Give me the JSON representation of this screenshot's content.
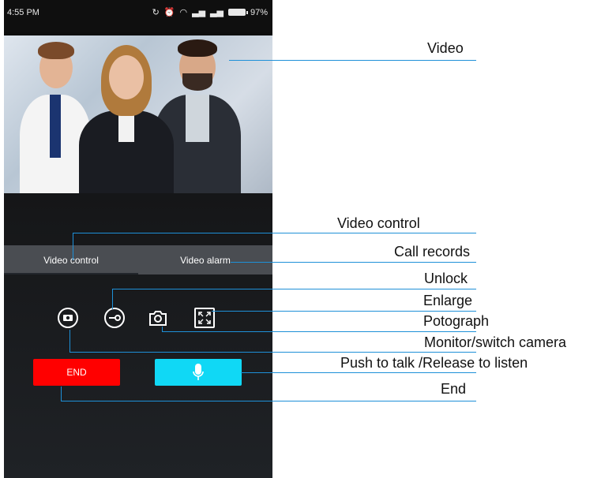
{
  "status_bar": {
    "time": "4:55 PM",
    "battery": "97%"
  },
  "tabs": {
    "video_control": "Video control",
    "video_alarm": "Video alarm"
  },
  "buttons": {
    "end": "END"
  },
  "annotations": {
    "video": "Video",
    "video_control": "Video control",
    "call_records": "Call records",
    "unlock": "Unlock",
    "enlarge": "Enlarge",
    "photograph": "Potograph",
    "monitor": "Monitor/switch camera",
    "push_to_talk": "Push to talk /Release to listen",
    "end": "End"
  },
  "colors": {
    "end_button": "#ff0000",
    "talk_button": "#10d8f5",
    "annotation_line": "#1e90d8",
    "tab_bar": "#4a4d52"
  },
  "icons": [
    "monitor-camera-icon",
    "unlock-key-icon",
    "camera-icon",
    "enlarge-icon",
    "microphone-icon"
  ]
}
